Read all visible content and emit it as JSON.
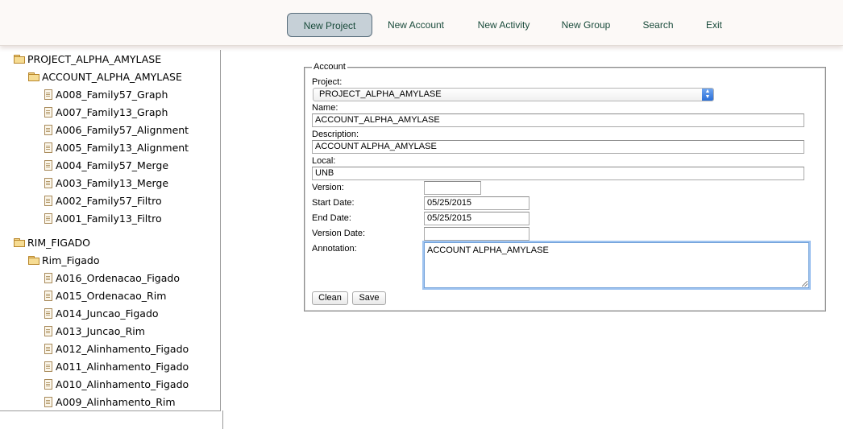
{
  "nav": {
    "items": [
      "New Project",
      "New Account",
      "New Activity",
      "New Group",
      "Search",
      "Exit"
    ],
    "active": "New Project"
  },
  "tree": {
    "projects": [
      {
        "label": "PROJECT_ALPHA_AMYLASE",
        "accounts": [
          {
            "label": "ACCOUNT_ALPHA_AMYLASE",
            "activities": [
              "A008_Family57_Graph",
              "A007_Family13_Graph",
              "A006_Family57_Alignment",
              "A005_Family13_Alignment",
              "A004_Family57_Merge",
              "A003_Family13_Merge",
              "A002_Family57_Filtro",
              "A001_Family13_Filtro"
            ]
          }
        ]
      },
      {
        "label": "RIM_FIGADO",
        "accounts": [
          {
            "label": "Rim_Figado",
            "activities": [
              "A016_Ordenacao_Figado",
              "A015_Ordenacao_Rim",
              "A014_Juncao_Figado",
              "A013_Juncao_Rim",
              "A012_Alinhamento_Figado",
              "A011_Alinhamento_Figado",
              "A010_Alinhamento_Figado",
              "A009_Alinhamento_Rim"
            ]
          }
        ]
      }
    ]
  },
  "form": {
    "legend": "Account",
    "project_label": "Project:",
    "project_value": "PROJECT_ALPHA_AMYLASE",
    "name_label": "Name:",
    "name_value": "ACCOUNT_ALPHA_AMYLASE",
    "description_label": "Description:",
    "description_value": "ACCOUNT ALPHA_AMYLASE",
    "local_label": "Local:",
    "local_value": "UNB",
    "version_label": "Version:",
    "version_value": "",
    "start_date_label": "Start Date:",
    "start_date_value": "05/25/2015",
    "end_date_label": "End Date:",
    "end_date_value": "05/25/2015",
    "version_date_label": "Version Date:",
    "version_date_value": "",
    "annotation_label": "Annotation:",
    "annotation_value": "ACCOUNT ALPHA_AMYLASE",
    "clean_label": "Clean",
    "save_label": "Save"
  },
  "icons": {
    "folder": "folder-icon",
    "file": "file-icon",
    "select_arrows": "up-down-arrows-icon"
  },
  "colors": {
    "nav_text": "#184a3a",
    "nav_active_bg": "#c6d0d7",
    "focus_ring": "#9ec3f0",
    "select_arrow": "#2b6fd8"
  }
}
